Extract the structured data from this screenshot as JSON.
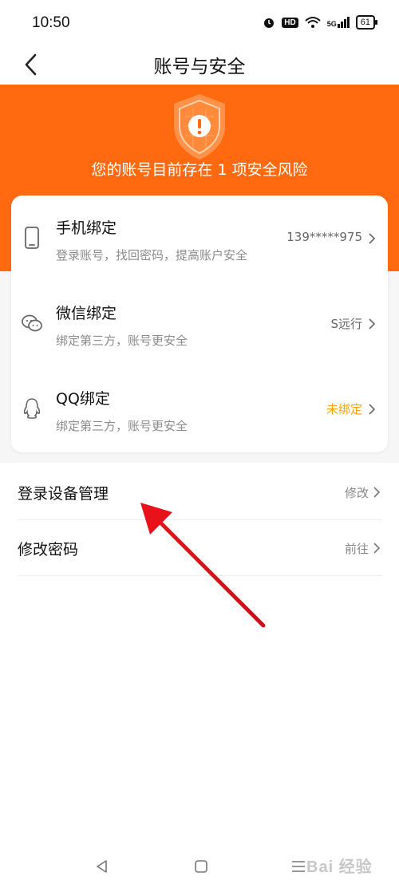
{
  "status_bar": {
    "time": "10:50",
    "hd": "HD",
    "network": "5G",
    "battery": "61"
  },
  "nav": {
    "title": "账号与安全"
  },
  "hero": {
    "risk_text": "您的账号目前存在 1 项安全风险",
    "bg_color": "#ff6a10"
  },
  "bindings": [
    {
      "title": "手机绑定",
      "desc": "登录账号，找回密码，提高账户安全",
      "value": "139*****975",
      "icon": "phone-icon"
    },
    {
      "title": "微信绑定",
      "desc": "绑定第三方，账号更安全",
      "value": "S远行",
      "icon": "wechat-icon"
    },
    {
      "title": "QQ绑定",
      "desc": "绑定第三方，账号更安全",
      "value": "未绑定",
      "icon": "qq-icon",
      "value_color": "#f3a311"
    }
  ],
  "list": [
    {
      "label": "登录设备管理",
      "value": "修改"
    },
    {
      "label": "修改密码",
      "value": "前往"
    }
  ],
  "watermark": "Bai 经验"
}
